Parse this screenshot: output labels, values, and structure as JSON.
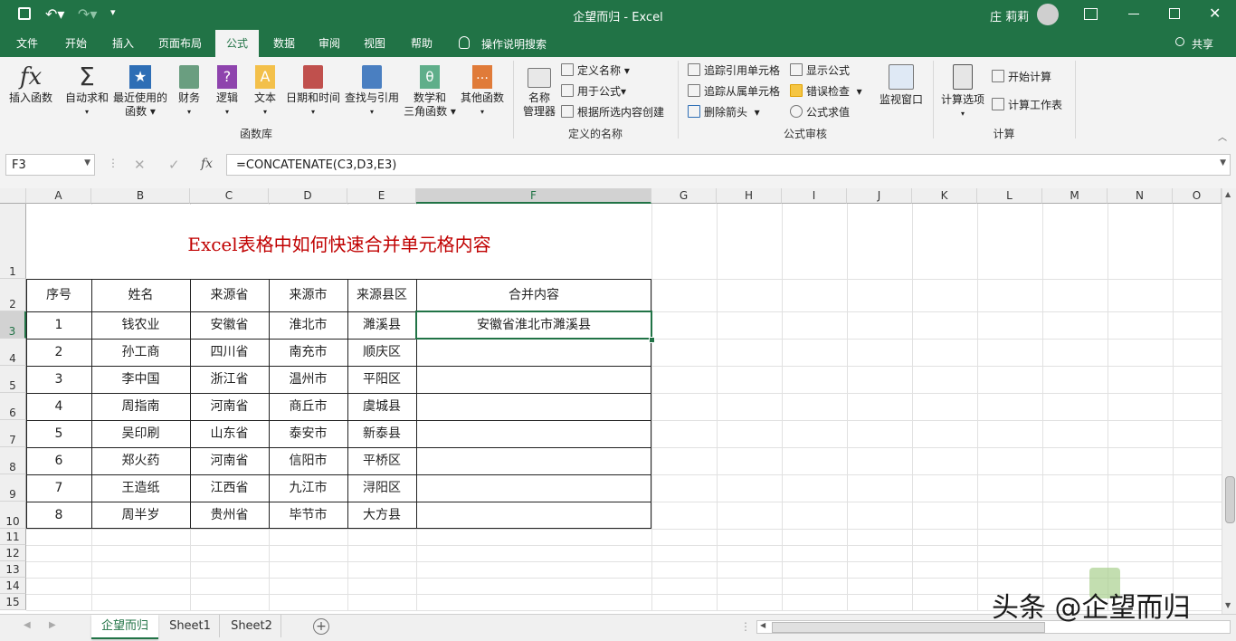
{
  "titlebar": {
    "title": "企望而归  -  Excel",
    "user": "庄 莉莉"
  },
  "tabs": [
    "文件",
    "开始",
    "插入",
    "页面布局",
    "公式",
    "数据",
    "审阅",
    "视图",
    "帮助"
  ],
  "active_tab": "公式",
  "tell_me": "操作说明搜索",
  "share": "共享",
  "ribbon": {
    "insert_function": "插入函数",
    "autosum": "自动求和",
    "recent_1": "最近使用的",
    "recent_2": "函数",
    "financial": "财务",
    "logical": "逻辑",
    "text": "文本",
    "datetime": "日期和时间",
    "lookup": "查找与引用",
    "math_1": "数学和",
    "math_2": "三角函数",
    "more": "其他函数",
    "group_library": "函数库",
    "name_mgr_1": "名称",
    "name_mgr_2": "管理器",
    "define_name": "定义名称",
    "use_in_formula": "用于公式",
    "create_from_sel": "根据所选内容创建",
    "group_names": "定义的名称",
    "trace_precedents": "追踪引用单元格",
    "trace_dependents": "追踪从属单元格",
    "remove_arrows": "删除箭头",
    "show_formulas": "显示公式",
    "error_check": "错误检查",
    "evaluate": "公式求值",
    "watch": "监视窗口",
    "group_audit": "公式审核",
    "calc_options": "计算选项",
    "calc_now": "开始计算",
    "calc_sheet": "计算工作表",
    "group_calc": "计算"
  },
  "formula_bar": {
    "name_box": "F3",
    "formula": "=CONCATENATE(C3,D3,E3)",
    "fx": "fx"
  },
  "columns": [
    "A",
    "B",
    "C",
    "D",
    "E",
    "F",
    "G",
    "H",
    "I",
    "J",
    "K",
    "L",
    "M",
    "N",
    "O"
  ],
  "rows": [
    "1",
    "2",
    "3",
    "4",
    "5",
    "6",
    "7",
    "8",
    "9",
    "10",
    "11",
    "12",
    "13",
    "14",
    "15"
  ],
  "sheet_title": "Excel表格中如何快速合并单元格内容",
  "table_headers": [
    "序号",
    "姓名",
    "来源省",
    "来源市",
    "来源县区",
    "合并内容"
  ],
  "table_rows": [
    [
      "1",
      "钱农业",
      "安徽省",
      "淮北市",
      "濉溪县",
      "安徽省淮北市濉溪县"
    ],
    [
      "2",
      "孙工商",
      "四川省",
      "南充市",
      "顺庆区",
      ""
    ],
    [
      "3",
      "李中国",
      "浙江省",
      "温州市",
      "平阳区",
      ""
    ],
    [
      "4",
      "周指南",
      "河南省",
      "商丘市",
      "虞城县",
      ""
    ],
    [
      "5",
      "吴印刷",
      "山东省",
      "泰安市",
      "新泰县",
      ""
    ],
    [
      "6",
      "郑火药",
      "河南省",
      "信阳市",
      "平桥区",
      ""
    ],
    [
      "7",
      "王造纸",
      "江西省",
      "九江市",
      "浔阳区",
      ""
    ],
    [
      "8",
      "周半岁",
      "贵州省",
      "毕节市",
      "大方县",
      ""
    ]
  ],
  "sheets": [
    "企望而归",
    "Sheet1",
    "Sheet2"
  ],
  "watermark": "头条 @企望而归",
  "colors": {
    "excel_green": "#217346",
    "title_red": "#c00000",
    "selection": "#217346"
  }
}
